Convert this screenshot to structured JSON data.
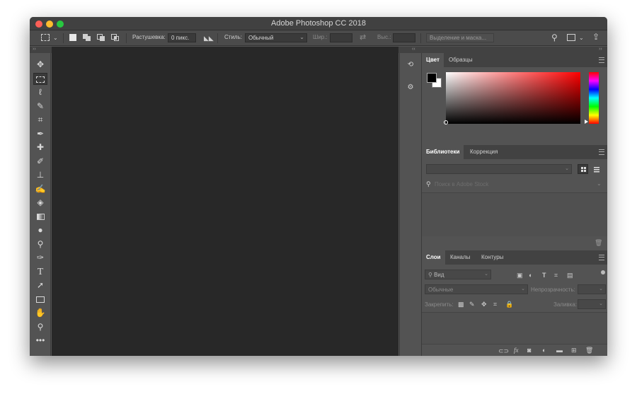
{
  "window": {
    "title": "Adobe Photoshop CC 2018",
    "traffic_colors": [
      "#fd5f57",
      "#febc2e",
      "#28c840"
    ]
  },
  "options_bar": {
    "feather_label": "Растушевка:",
    "feather_value": "0 пикс.",
    "style_label": "Стиль:",
    "style_value": "Обычный",
    "width_label": "Шир.:",
    "height_label": "Выс.:",
    "select_mask_label": "Выделение и маска..."
  },
  "toolbar": {
    "tools": [
      "move",
      "marquee",
      "lasso",
      "quick-select",
      "crop",
      "eyedropper",
      "healing",
      "brush",
      "stamp",
      "history-brush",
      "eraser",
      "gradient",
      "blur",
      "dodge",
      "pen",
      "type",
      "path-select",
      "rectangle",
      "hand",
      "zoom",
      "more"
    ],
    "selected": "marquee"
  },
  "color_panel": {
    "tabs": [
      "Цвет",
      "Образцы"
    ],
    "active_tab": "Цвет",
    "foreground": "#000000",
    "background": "#ffffff",
    "hue_base": "#ff0000"
  },
  "libraries_panel": {
    "tabs": [
      "Библиотеки",
      "Коррекция"
    ],
    "active_tab": "Библиотеки",
    "search_placeholder": "Поиск в Adobe Stock"
  },
  "layers_panel": {
    "tabs": [
      "Слои",
      "Каналы",
      "Контуры"
    ],
    "active_tab": "Слои",
    "kind_filter": "Вид",
    "blend_mode": "Обычные",
    "opacity_label": "Непрозрачность:",
    "lock_label": "Закрепить:",
    "fill_label": "Заливка:"
  },
  "bottom_icons": [
    "link-icon",
    "fx-icon",
    "mask-icon",
    "adjustment-icon",
    "folder-icon",
    "new-layer-icon",
    "trash-icon"
  ]
}
